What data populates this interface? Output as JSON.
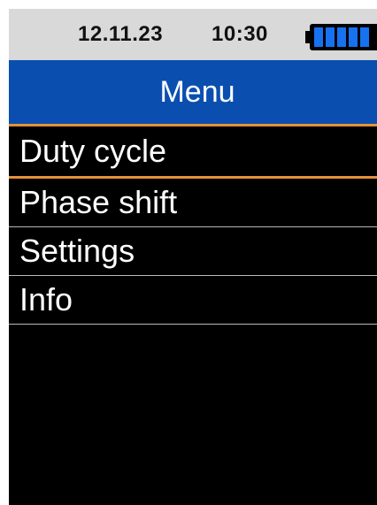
{
  "status_bar": {
    "date": "12.11.23",
    "time": "10:30",
    "battery": {
      "icon": "battery-icon",
      "level": 1.0,
      "cells": 5,
      "color": "#1672f0"
    }
  },
  "header": {
    "title": "Menu",
    "color": "#0a4fb0"
  },
  "menu": {
    "accent_color": "#e6913a",
    "selected_index": 0,
    "items": [
      {
        "label": "Duty cycle"
      },
      {
        "label": "Phase shift"
      },
      {
        "label": "Settings"
      },
      {
        "label": "Info"
      }
    ]
  }
}
